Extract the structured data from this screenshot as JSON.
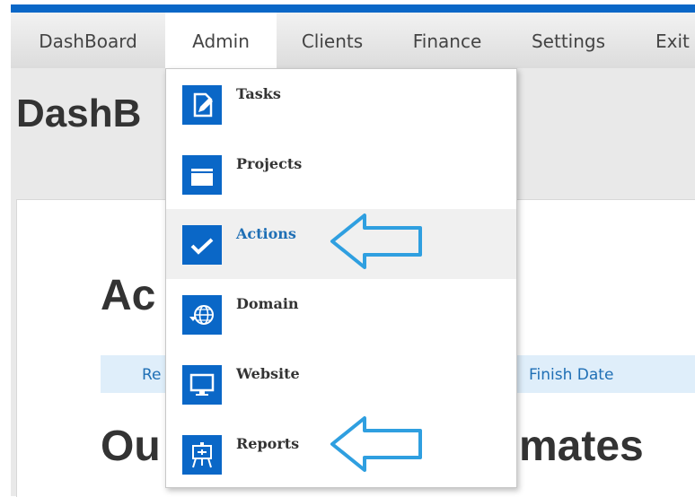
{
  "nav": {
    "items": [
      {
        "label": "DashBoard"
      },
      {
        "label": "Admin"
      },
      {
        "label": "Clients"
      },
      {
        "label": "Finance"
      },
      {
        "label": "Settings"
      },
      {
        "label": "Exit"
      }
    ],
    "active_item": "Admin"
  },
  "page": {
    "title_fragment": "DashB",
    "heading_fragment": "Ac",
    "table_header_fragment": "Re",
    "finish_date_header": "Finish Date",
    "heading2_left_fragment": "Ou",
    "heading2_right_fragment": "mates"
  },
  "dropdown": {
    "items": [
      {
        "label": "Tasks",
        "icon": "tasks-icon"
      },
      {
        "label": "Projects",
        "icon": "folder-icon"
      },
      {
        "label": "Actions",
        "icon": "checkmark-icon"
      },
      {
        "label": "Domain",
        "icon": "globe-icon"
      },
      {
        "label": "Website",
        "icon": "monitor-icon"
      },
      {
        "label": "Reports",
        "icon": "easel-icon"
      }
    ],
    "highlighted_item": "Actions"
  },
  "colors": {
    "accent": "#0a67c7",
    "arrow": "#2f9fe0",
    "link": "#1f6fb5"
  }
}
